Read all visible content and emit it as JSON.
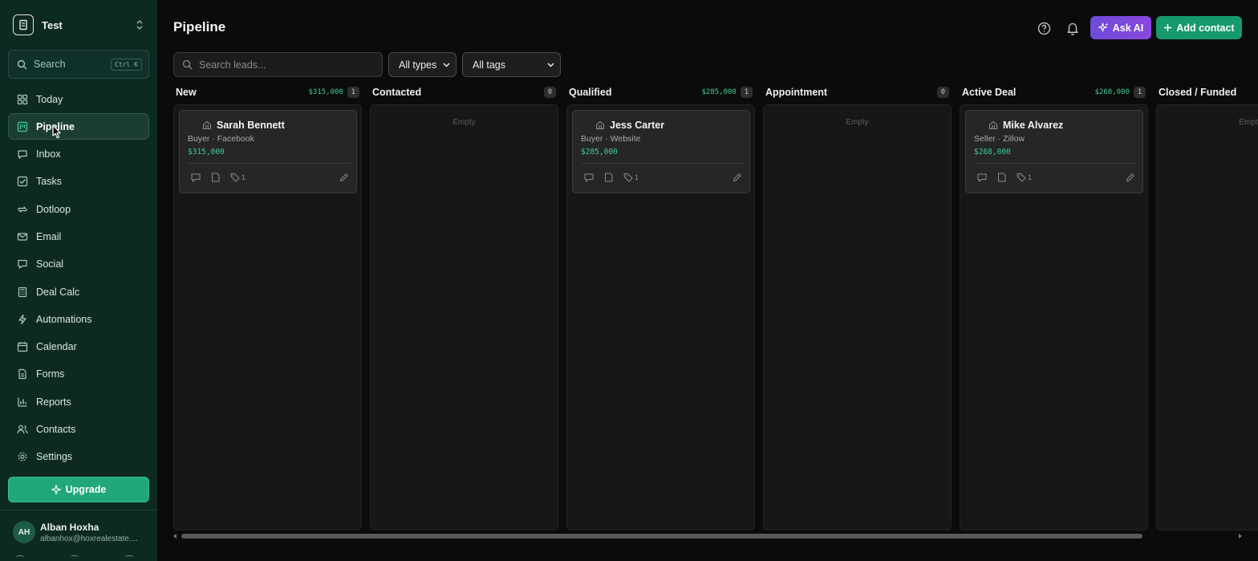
{
  "workspace": {
    "name": "Test"
  },
  "sidebar": {
    "search": {
      "label": "Search",
      "shortcut": "Ctrl K"
    },
    "items": [
      {
        "label": "Today",
        "icon": "grid-icon"
      },
      {
        "label": "Pipeline",
        "icon": "kanban-icon",
        "active": true
      },
      {
        "label": "Inbox",
        "icon": "chat-icon"
      },
      {
        "label": "Tasks",
        "icon": "checkbox-icon"
      },
      {
        "label": "Dotloop",
        "icon": "loop-icon"
      },
      {
        "label": "Email",
        "icon": "mail-icon"
      },
      {
        "label": "Social",
        "icon": "message-icon"
      },
      {
        "label": "Deal Calc",
        "icon": "calculator-icon"
      },
      {
        "label": "Automations",
        "icon": "bolt-icon"
      },
      {
        "label": "Calendar",
        "icon": "calendar-icon"
      },
      {
        "label": "Forms",
        "icon": "form-icon"
      },
      {
        "label": "Reports",
        "icon": "bar-chart-icon"
      },
      {
        "label": "Contacts",
        "icon": "users-icon"
      },
      {
        "label": "Settings",
        "icon": "gear-icon"
      }
    ],
    "upgrade_label": "Upgrade",
    "user": {
      "initials": "AH",
      "name": "Alban Hoxha",
      "email": "albanhox@hoxrealestate...."
    }
  },
  "header": {
    "title": "Pipeline",
    "ask_ai_label": "Ask AI",
    "add_contact_label": "Add contact"
  },
  "filters": {
    "search_placeholder": "Search leads...",
    "types": {
      "selected": "All types"
    },
    "tags": {
      "selected": "All tags"
    }
  },
  "board": {
    "empty_label": "Empty",
    "columns": [
      {
        "title": "New",
        "total": "$315,000",
        "count": "1",
        "cards": [
          {
            "name": "Sarah Bennett",
            "meta": "Buyer · Facebook",
            "value": "$315,000",
            "tags": "1"
          }
        ]
      },
      {
        "title": "Contacted",
        "total": "",
        "count": "0",
        "cards": []
      },
      {
        "title": "Qualified",
        "total": "$285,000",
        "count": "1",
        "cards": [
          {
            "name": "Jess Carter",
            "meta": "Buyer · Website",
            "value": "$285,000",
            "tags": "1"
          }
        ]
      },
      {
        "title": "Appointment",
        "total": "",
        "count": "0",
        "cards": []
      },
      {
        "title": "Active Deal",
        "total": "$268,000",
        "count": "1",
        "cards": [
          {
            "name": "Mike Alvarez",
            "meta": "Seller · Zillow",
            "value": "$268,000",
            "tags": "1"
          }
        ]
      },
      {
        "title": "Closed / Funded",
        "total": "",
        "count": "",
        "cards": []
      }
    ]
  },
  "colors": {
    "sidebar_bg": "#0d2a22",
    "accent_green": "#22a77a",
    "money_green": "#3ccf92",
    "ai_purple": "#7b49dc"
  }
}
